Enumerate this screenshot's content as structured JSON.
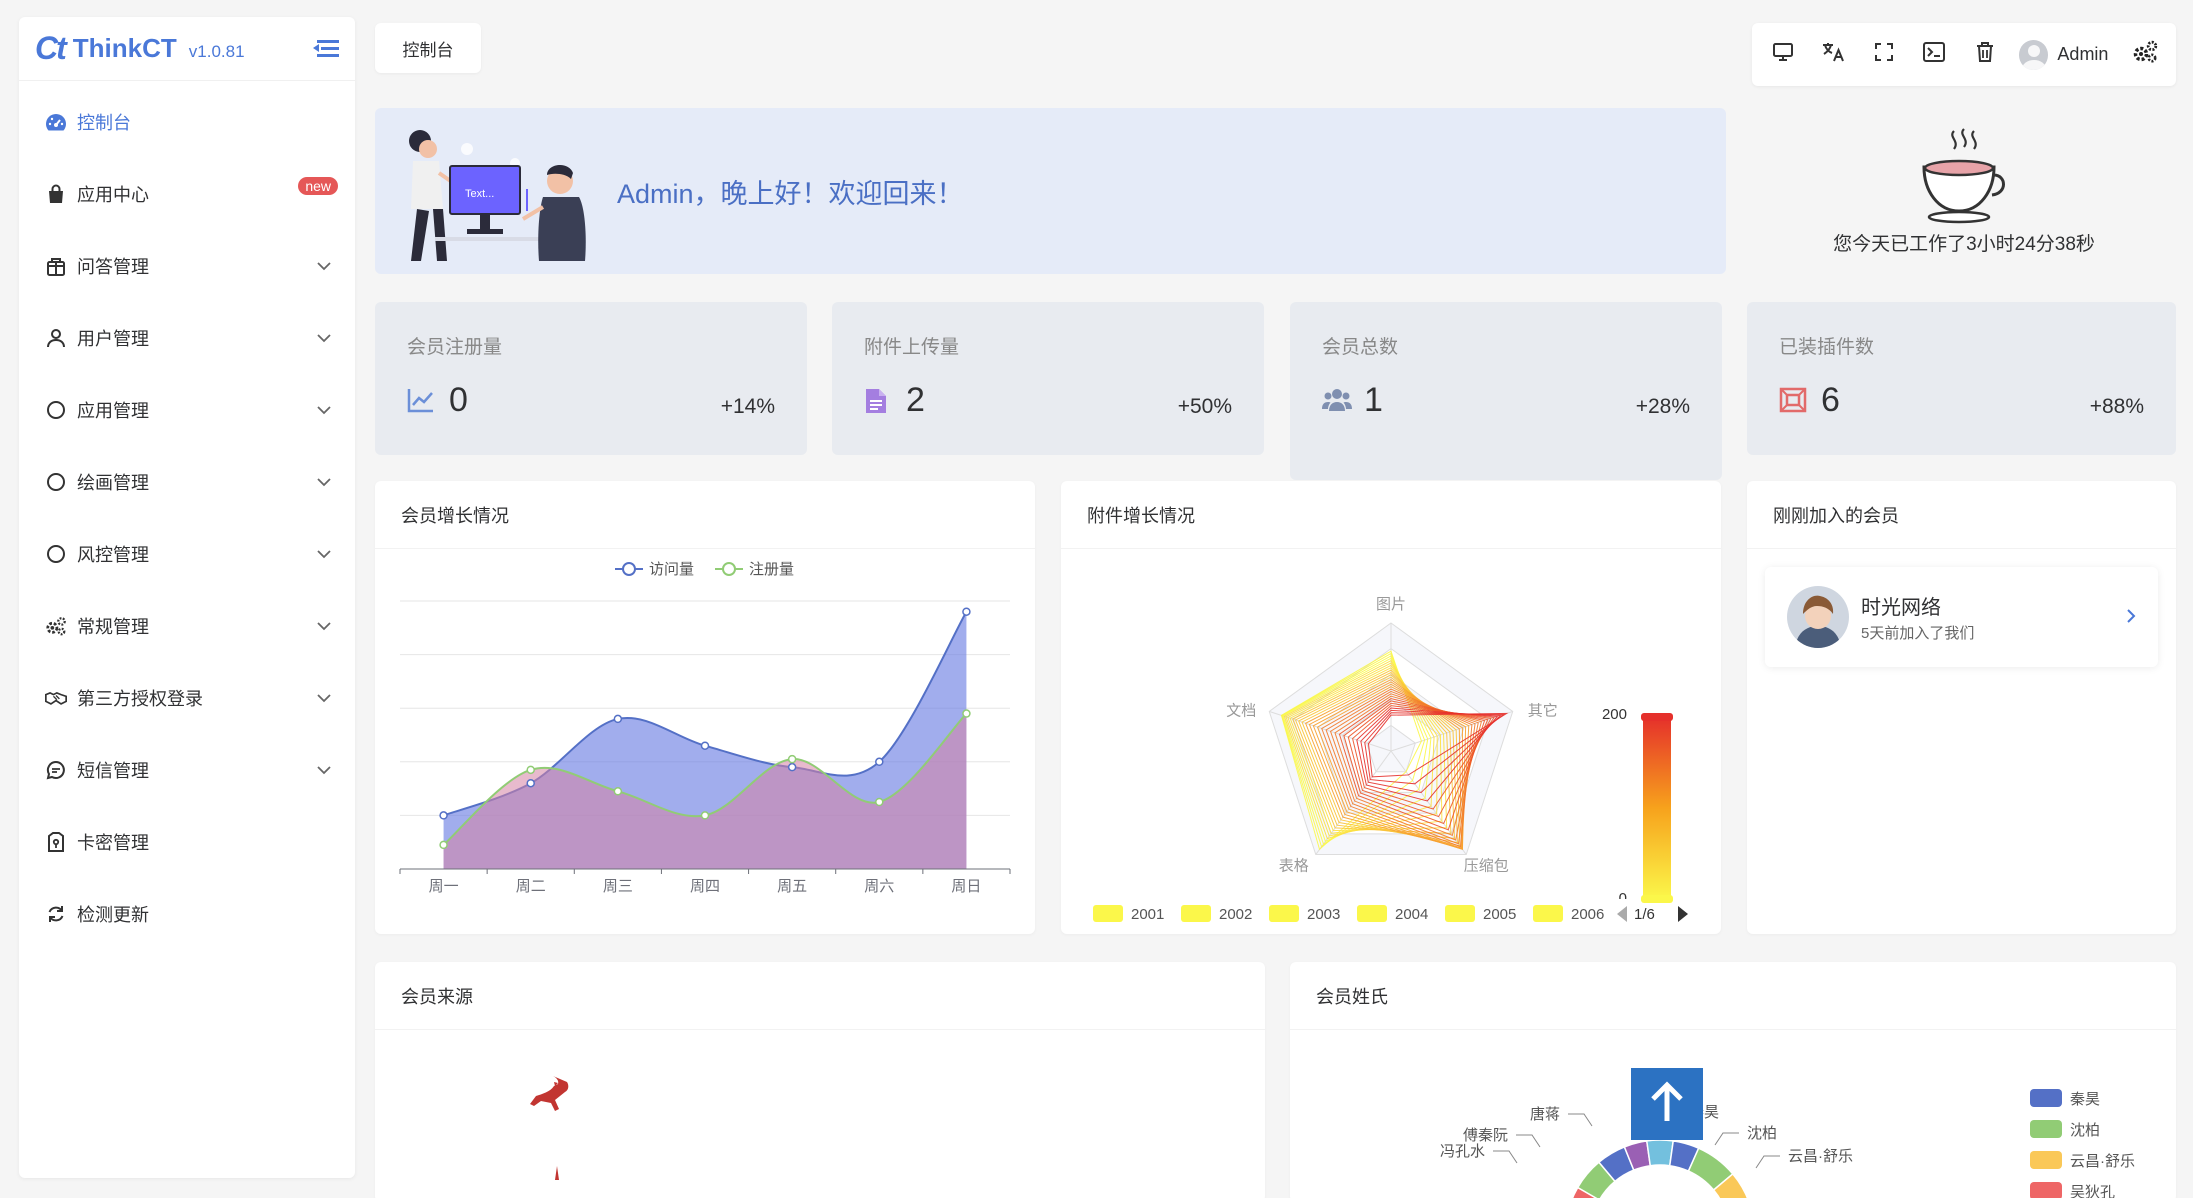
{
  "brand": {
    "logo": "Ct",
    "name": "ThinkCT",
    "version": "v1.0.81"
  },
  "sidebar": {
    "items": [
      {
        "label": "控制台",
        "icon": "dashboard-icon",
        "active": true,
        "arrow": false
      },
      {
        "label": "应用中心",
        "icon": "shopping-bag-icon",
        "badge": "new",
        "arrow": false
      },
      {
        "label": "问答管理",
        "icon": "gift-box-icon",
        "arrow": true
      },
      {
        "label": "用户管理",
        "icon": "user-icon",
        "arrow": true
      },
      {
        "label": "应用管理",
        "icon": "circle-icon",
        "arrow": true
      },
      {
        "label": "绘画管理",
        "icon": "circle-icon",
        "arrow": true
      },
      {
        "label": "风控管理",
        "icon": "circle-icon",
        "arrow": true
      },
      {
        "label": "常规管理",
        "icon": "gears-icon",
        "arrow": true
      },
      {
        "label": "第三方授权登录",
        "icon": "handshake-icon",
        "arrow": true
      },
      {
        "label": "短信管理",
        "icon": "message-icon",
        "arrow": true
      },
      {
        "label": "卡密管理",
        "icon": "card-lock-icon",
        "arrow": false
      },
      {
        "label": "检测更新",
        "icon": "refresh-icon",
        "arrow": false
      }
    ]
  },
  "tabs": [
    {
      "label": "控制台"
    }
  ],
  "toolbar": {
    "user": "Admin"
  },
  "welcome": {
    "text": "Admin，晚上好！欢迎回来！",
    "illustration_text": "Text..."
  },
  "worktime": {
    "text": "您今天已工作了3小时24分38秒"
  },
  "stats": [
    {
      "title": "会员注册量",
      "value": "0",
      "pct": "+14%",
      "icon": "line-chart-icon",
      "color": "#6b8fd8"
    },
    {
      "title": "附件上传量",
      "value": "2",
      "pct": "+50%",
      "icon": "file-icon",
      "color": "#a47ee0"
    },
    {
      "title": "会员总数",
      "value": "1",
      "pct": "+28%",
      "icon": "users-icon",
      "color": "#7f8fb0"
    },
    {
      "title": "已装插件数",
      "value": "6",
      "pct": "+88%",
      "icon": "plugin-icon",
      "color": "#e26a6a"
    }
  ],
  "cards": {
    "member_growth": "会员增长情况",
    "attachment_growth": "附件增长情况",
    "new_members": "刚刚加入的会员",
    "member_source": "会员来源",
    "member_surname": "会员姓氏"
  },
  "new_member": {
    "name": "时光网络",
    "sub": "5天前加入了我们"
  },
  "chart_data": [
    {
      "type": "area",
      "title": "会员增长情况",
      "categories": [
        "周一",
        "周二",
        "周三",
        "周四",
        "周五",
        "周六",
        "周日"
      ],
      "series": [
        {
          "name": "访问量",
          "values": [
            100,
            160,
            280,
            230,
            190,
            200,
            480
          ],
          "color": "#5470c6"
        },
        {
          "name": "注册量",
          "values": [
            45,
            185,
            145,
            100,
            205,
            125,
            290
          ],
          "color": "#91cc75"
        }
      ],
      "ylim": [
        0,
        500
      ]
    },
    {
      "type": "radar",
      "title": "附件增长情况",
      "indicators": [
        "图片",
        "其它",
        "压缩包",
        "表格",
        "文档"
      ],
      "legend": [
        "2001",
        "2002",
        "2003",
        "2004",
        "2005",
        "2006"
      ],
      "legend_page": "1/6",
      "visual_map": {
        "min": 0,
        "max": 200,
        "min_label": "0",
        "max_label": "200"
      }
    },
    {
      "type": "pie",
      "title": "会员姓氏",
      "legend": [
        "秦昊",
        "沈柏",
        "云昌·舒乐",
        "吴狄孔"
      ],
      "legend_colors": [
        "#5470c6",
        "#91cc75",
        "#fac858",
        "#ee6666"
      ],
      "labels": [
        "唐蒋",
        "傅秦阮",
        "冯孔水",
        "秦昊",
        "沈柏",
        "云昌·舒乐"
      ]
    }
  ]
}
